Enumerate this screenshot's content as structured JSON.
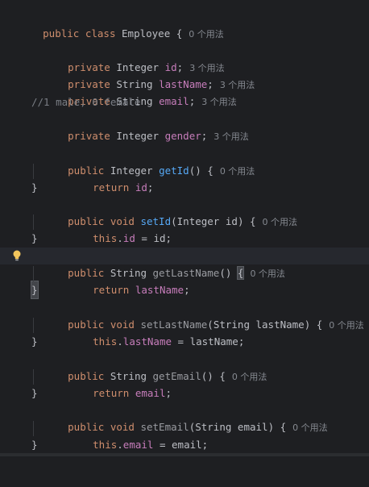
{
  "usages_hint": "0 个用法",
  "usages3_hint": "3 个用法",
  "class_decl": {
    "kw1": "public",
    "kw2": "class",
    "name": "Employee",
    "brace": "{"
  },
  "fields": [
    {
      "kw": "private",
      "type": "Integer",
      "name": "id"
    },
    {
      "kw": "private",
      "type": "String",
      "name": "lastName"
    },
    {
      "kw": "private",
      "type": "String",
      "name": "email"
    },
    {
      "kw": "private",
      "type": "Integer",
      "name": "gender"
    }
  ],
  "comment": "//1 male, 0 female",
  "kw": {
    "public": "public",
    "void": "void",
    "return": "return",
    "this": "this"
  },
  "methods": {
    "getId": {
      "type": "Integer",
      "name": "getId",
      "ret": "id"
    },
    "setId": {
      "name": "setId",
      "ptype": "Integer",
      "pname": "id",
      "field": "id"
    },
    "getLastName": {
      "type": "String",
      "name": "getLastName",
      "ret": "lastName"
    },
    "setLastName": {
      "name": "setLastName",
      "ptype": "String",
      "pname": "lastName",
      "field": "lastName"
    },
    "getEmail": {
      "type": "String",
      "name": "getEmail",
      "ret": "email"
    },
    "setEmail": {
      "name": "setEmail",
      "ptype": "String",
      "pname": "email",
      "field": "email"
    }
  },
  "punct": {
    "semi": ";",
    "open": "() {",
    "close": "}",
    "eq": " = ",
    "paren_open": "(",
    "paren_close": ") {",
    "dot": "."
  }
}
